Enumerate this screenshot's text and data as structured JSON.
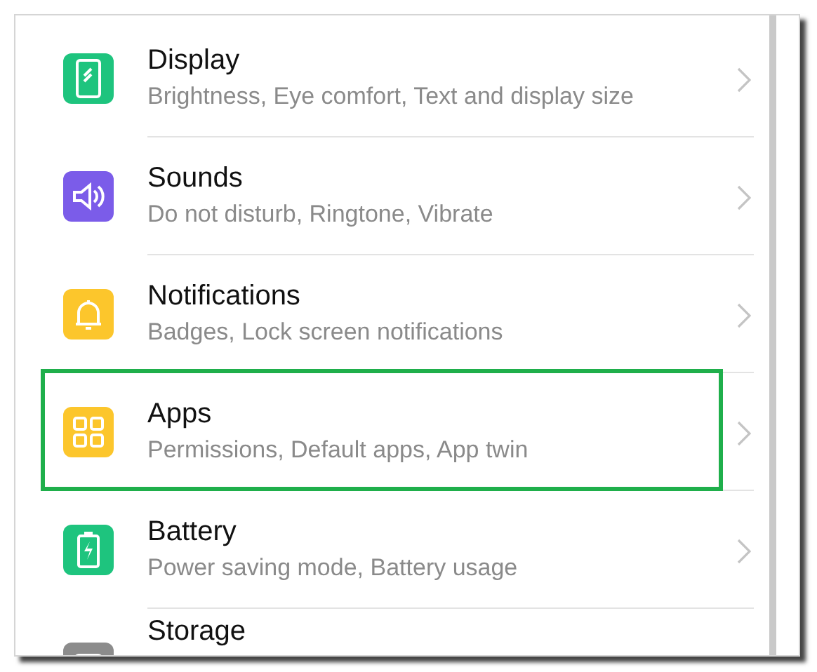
{
  "settings": [
    {
      "kind": "display",
      "color": "#1ec47e",
      "title": "Display",
      "subtitle": "Brightness, Eye comfort, Text and display size",
      "highlighted": false
    },
    {
      "kind": "sound",
      "color": "#7b5ce9",
      "title": "Sounds",
      "subtitle": "Do not disturb, Ringtone, Vibrate",
      "highlighted": false
    },
    {
      "kind": "bell",
      "color": "#fcc62c",
      "title": "Notifications",
      "subtitle": "Badges, Lock screen notifications",
      "highlighted": false
    },
    {
      "kind": "apps",
      "color": "#fcc62c",
      "title": "Apps",
      "subtitle": "Permissions, Default apps, App twin",
      "highlighted": true
    },
    {
      "kind": "battery",
      "color": "#1ec47e",
      "title": "Battery",
      "subtitle": "Power saving mode, Battery usage",
      "highlighted": false
    },
    {
      "kind": "storage",
      "color": "#8c8c8c",
      "title": "Storage",
      "highlighted": false
    }
  ]
}
